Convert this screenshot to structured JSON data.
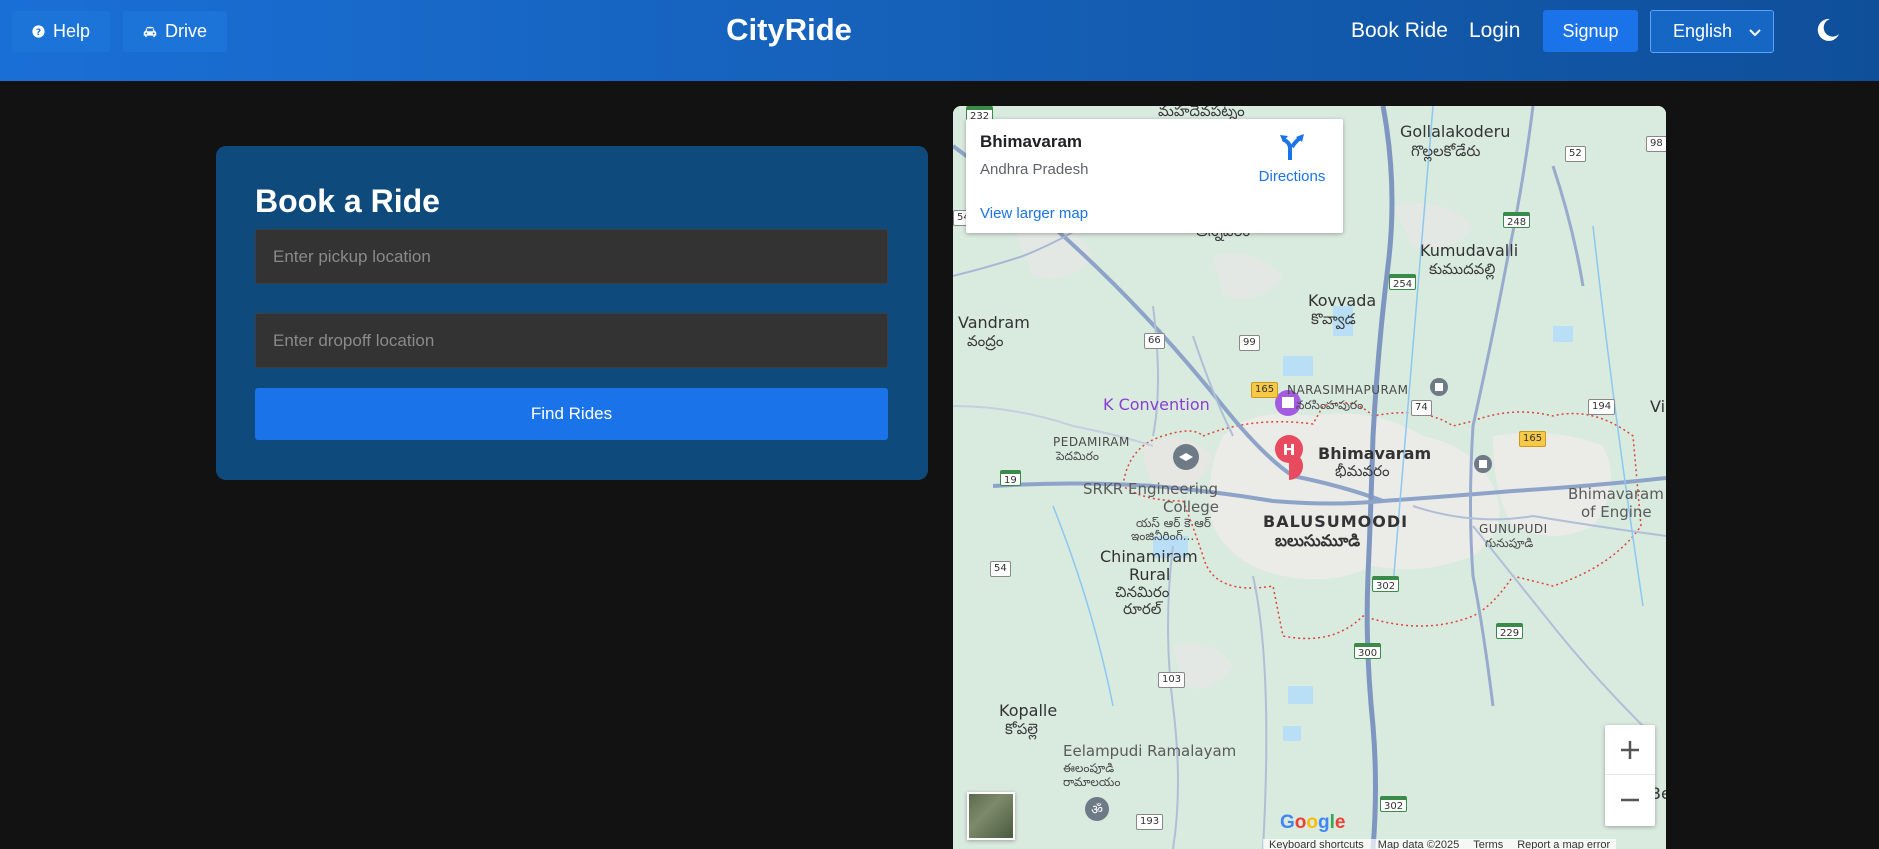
{
  "header": {
    "help_label": "Help",
    "drive_label": "Drive",
    "brand": "CityRide",
    "book_ride_label": "Book Ride",
    "login_label": "Login",
    "signup_label": "Signup",
    "language": "English"
  },
  "booking": {
    "title": "Book a Ride",
    "pickup_placeholder": "Enter pickup location",
    "dropoff_placeholder": "Enter dropoff location",
    "find_label": "Find Rides"
  },
  "map": {
    "info": {
      "title": "Bhimavaram",
      "subtitle": "Andhra Pradesh",
      "directions_label": "Directions",
      "larger_map_label": "View larger map"
    },
    "labels": {
      "top_town_te": "మహదేవపట్నం",
      "gollalakoderu": "Gollalakoderu",
      "gollalakoderu_te": "గొల్లలకోడేరు",
      "tokens_te": "అన్నవరం",
      "kumudavalli": "Kumudavalli",
      "kumudavalli_te": "కుముదవల్లి",
      "kovvada": "Kovvada",
      "kovvada_te": "కొవ్వాడ",
      "vandram": "Vandram",
      "vandram_te": "వంద్రం",
      "narasimhapuram": "NARASIMHAPURAM",
      "narasimhapuram_te": "నరసింహపురం",
      "k_convention": "K Convention",
      "pedamiram": "PEDAMIRAM",
      "pedamiram_te": "పెదమిరం",
      "bhimavaram": "Bhimavaram",
      "bhimavaram_te": "భీమవరం",
      "srkr": "SRKR Engineering",
      "srkr2": "College",
      "srkr_te": "యస్ ఆర్ కె ఆర్",
      "srkr_te2": "ఇంజినీరింగ్...",
      "balusumoodi": "BALUSUMOODI",
      "balusumoodi_te": "బలుసుమూడి",
      "gunupudi": "GUNUPUDI",
      "gunupudi_te": "గునుపూడి",
      "bhimavaram_eng": "Bhimavaram",
      "bhimavaram_eng2": "of Engine",
      "chinamiram": "Chinamiram",
      "chinamiram2": "Rural",
      "chinamiram_te": "చినమిరం",
      "chinamiram_te2": "రూరల్",
      "kopalle": "Kopalle",
      "kopalle_te": "కోపల్లె",
      "eelampudi": "Eelampudi Ramalayam",
      "eelampudi_te": "ఈలంపూడి",
      "eelampudi_te2": "రామాలయం",
      "vi": "Vi",
      "be": "Be"
    },
    "shields": {
      "s232": "232",
      "s52": "52",
      "s98": "98",
      "s248": "248",
      "s54a": "54",
      "s254": "254",
      "s66": "66",
      "s99": "99",
      "s165a": "165",
      "s74": "74",
      "s194": "194",
      "s165b": "165",
      "s19": "19",
      "s54b": "54",
      "s302a": "302",
      "s229": "229",
      "s300": "300",
      "s103": "103",
      "s193": "193",
      "s302b": "302"
    },
    "google_logo": "Google",
    "attribution": {
      "shortcuts": "Keyboard shortcuts",
      "data": "Map data ©2025",
      "terms": "Terms",
      "report": "Report a map error"
    }
  }
}
